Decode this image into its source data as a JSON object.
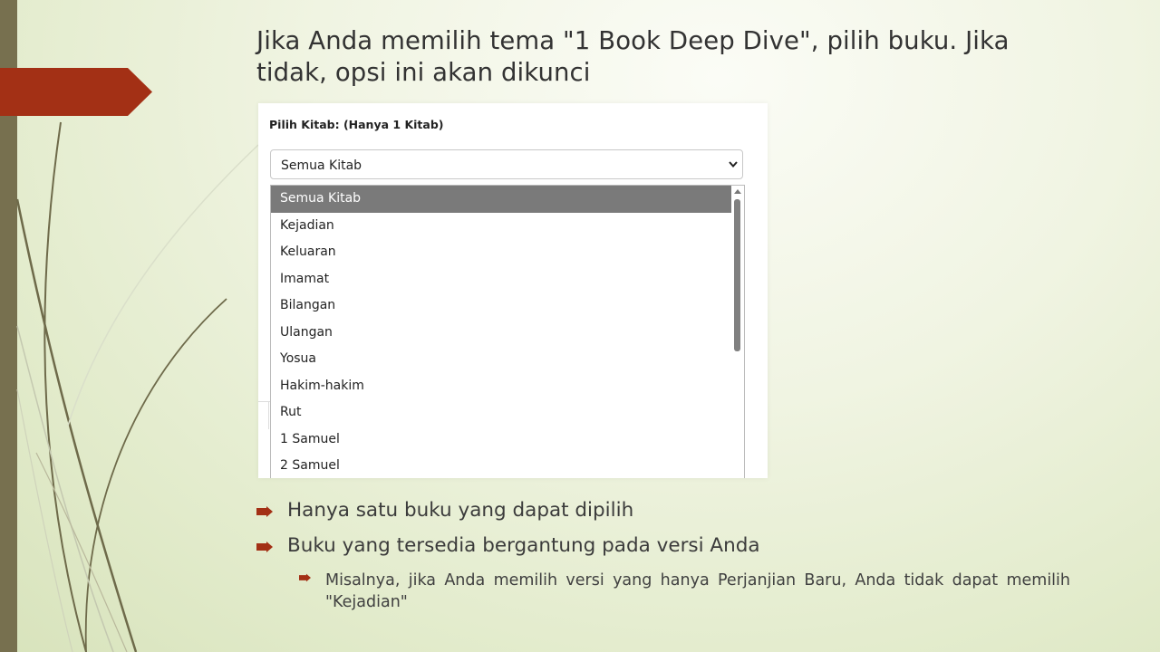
{
  "slide": {
    "title": "Jika Anda memilih tema \"1 Book Deep Dive\", pilih buku.  Jika tidak, opsi ini akan dikunci"
  },
  "screenshot": {
    "label": "Pilih Kitab: (Hanya 1 Kitab)",
    "select_value": "Semua Kitab",
    "options": [
      "Semua Kitab",
      "Kejadian",
      "Keluaran",
      "Imamat",
      "Bilangan",
      "Ulangan",
      "Yosua",
      "Hakim-hakim",
      "Rut",
      "1 Samuel",
      "2 Samuel"
    ],
    "selected_option": "Semua Kitab"
  },
  "bullets": [
    "Hanya satu buku yang dapat dipilih",
    "Buku yang tersedia bergantung pada versi Anda"
  ],
  "sub_bullets": [
    "Misalnya, jika Anda memilih versi yang hanya Perjanjian Baru, Anda tidak dapat memilih \"Kejadian\""
  ],
  "colors": {
    "accent_red": "#a33015",
    "left_bar": "#77704f",
    "selected_option_bg": "#7a7a7a"
  }
}
